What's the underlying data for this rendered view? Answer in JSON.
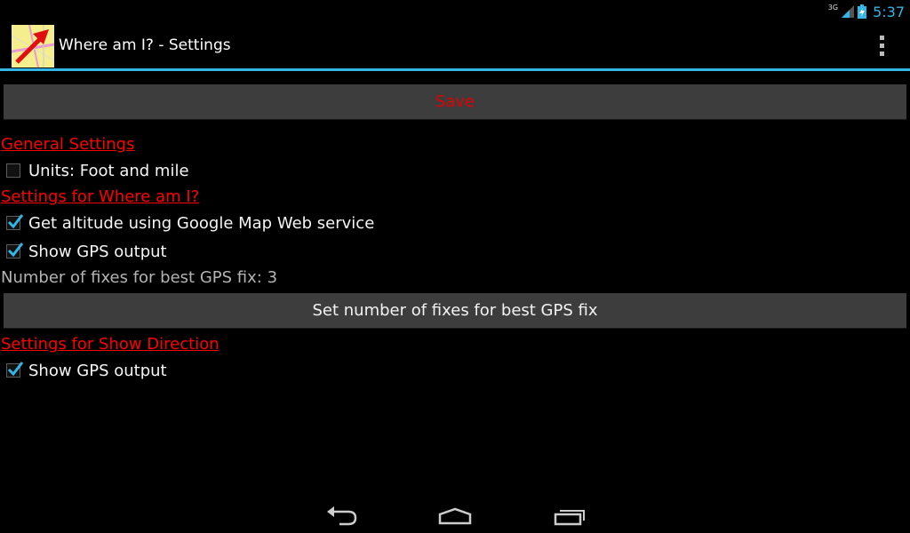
{
  "status": {
    "network": "3G",
    "time": "5:37"
  },
  "actionbar": {
    "title": "Where am I? - Settings",
    "app_icon": "map-arrow-icon",
    "overflow_icon": "overflow-menu-icon"
  },
  "save_label": "Save",
  "sections": {
    "general": "General Settings",
    "where": "Settings for Where am I?",
    "direction": "Settings for Show Direction"
  },
  "options": {
    "units": {
      "label": "Units: Foot and mile",
      "checked": false
    },
    "altitude": {
      "label": "Get altitude using Google Map Web service",
      "checked": true
    },
    "gps_output_where": {
      "label": "Show GPS output",
      "checked": true
    },
    "gps_output_direction": {
      "label": "Show GPS output",
      "checked": true
    }
  },
  "fixes": {
    "info": "Number of fixes for best GPS fix: 3",
    "button": "Set number of fixes for best GPS fix"
  },
  "navbar": {
    "back_icon": "back-icon",
    "home_icon": "home-icon",
    "recents_icon": "recent-apps-icon"
  },
  "colors": {
    "accent": "#33b5e5",
    "section": "#ff0000",
    "save_text": "#e00000",
    "button_bg": "#3d3d3d"
  }
}
